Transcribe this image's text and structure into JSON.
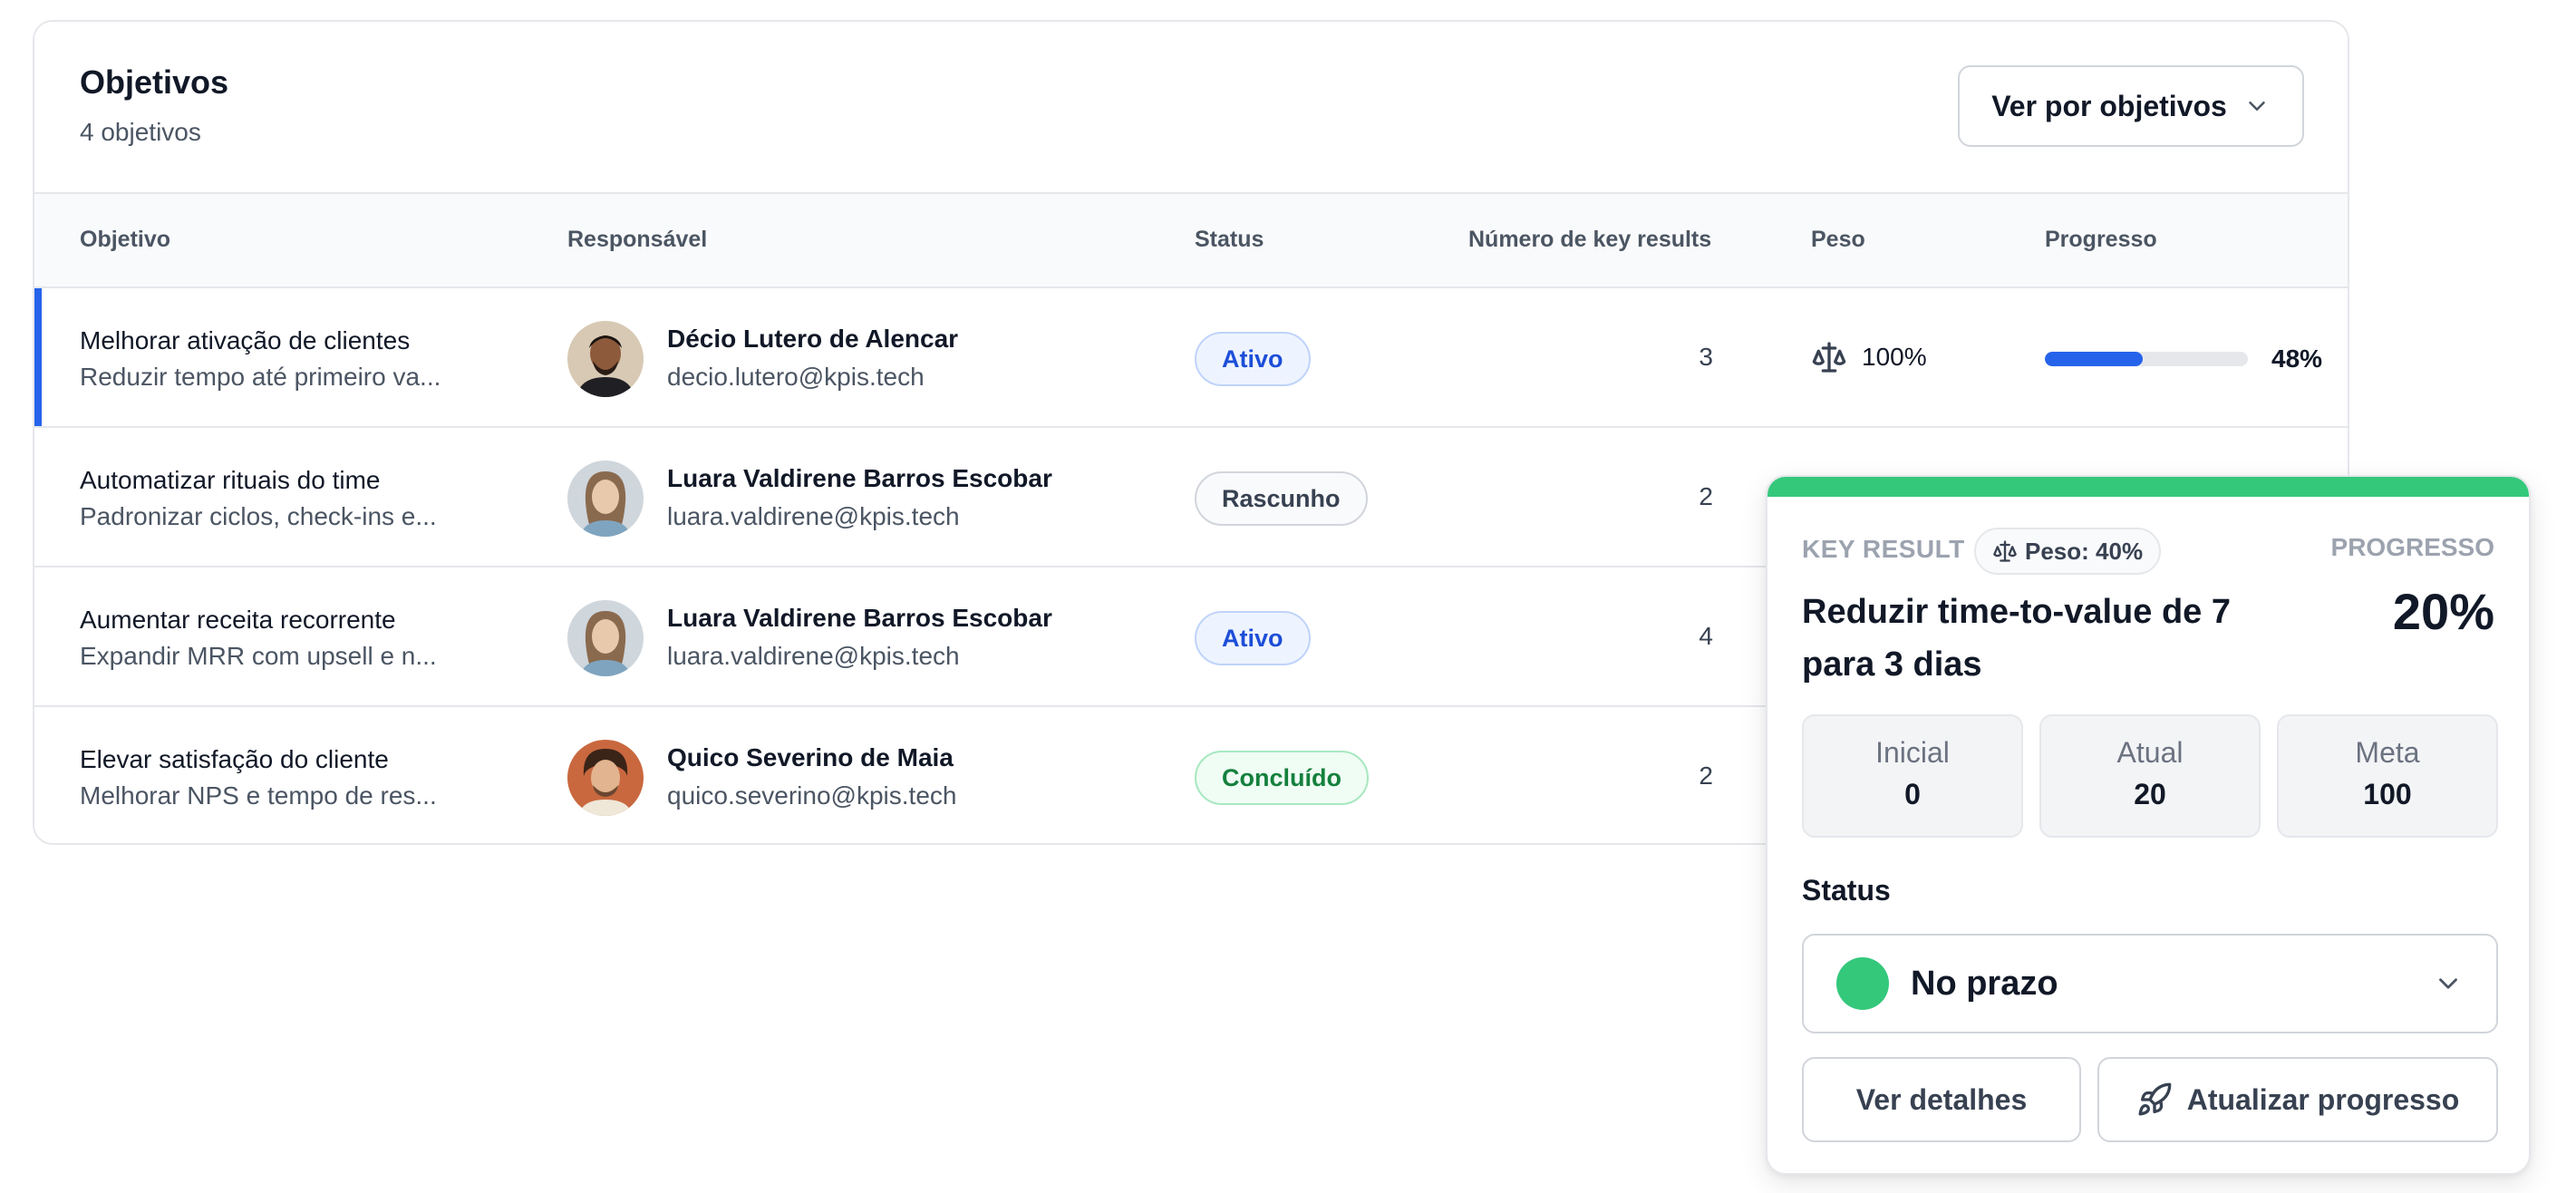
{
  "header": {
    "title": "Objetivos",
    "subtitle": "4 objetivos",
    "view_button": "Ver por objetivos"
  },
  "columns": {
    "objective": "Objetivo",
    "owner": "Responsável",
    "status": "Status",
    "kr_count": "Número de key results",
    "weight": "Peso",
    "progress": "Progresso"
  },
  "rows": [
    {
      "title": "Melhorar ativação de clientes",
      "subtitle": "Reduzir tempo até primeiro va...",
      "owner_name": "Décio Lutero de Alencar",
      "owner_email": "decio.lutero@kpis.tech",
      "status": "Ativo",
      "kr_count": "3",
      "weight": "100%",
      "progress_label": "48%",
      "progress": 0.48
    },
    {
      "title": "Automatizar rituais do time",
      "subtitle": "Padronizar ciclos, check-ins e...",
      "owner_name": "Luara Valdirene Barros Escobar",
      "owner_email": "luara.valdirene@kpis.tech",
      "status": "Rascunho",
      "kr_count": "2"
    },
    {
      "title": "Aumentar receita recorrente",
      "subtitle": "Expandir MRR com upsell e n...",
      "owner_name": "Luara Valdirene Barros Escobar",
      "owner_email": "luara.valdirene@kpis.tech",
      "status": "Ativo",
      "kr_count": "4"
    },
    {
      "title": "Elevar satisfação do cliente",
      "subtitle": "Melhorar NPS e tempo de res...",
      "owner_name": "Quico Severino de Maia",
      "owner_email": "quico.severino@kpis.tech",
      "status": "Concluído",
      "kr_count": "2"
    }
  ],
  "popover": {
    "kr_label": "KEY RESULT",
    "peso": "Peso: 40%",
    "progress_label": "PROGRESSO",
    "title": "Reduzir time-to-value de 7 para 3 dias",
    "progress_value": "20%",
    "stats": [
      {
        "label": "Inicial",
        "value": "0"
      },
      {
        "label": "Atual",
        "value": "20"
      },
      {
        "label": "Meta",
        "value": "100"
      }
    ],
    "status_label": "Status",
    "status_value": "No prazo",
    "details_button": "Ver detalhes",
    "update_button": "Atualizar progresso"
  },
  "colors": {
    "accent": "#2563eb",
    "on_track": "#34c87b"
  },
  "icons": {
    "view_toggle": "chevron-down-icon",
    "weight": "scale-icon",
    "status_dropdown": "chevron-down-icon",
    "update": "rocket-icon"
  }
}
